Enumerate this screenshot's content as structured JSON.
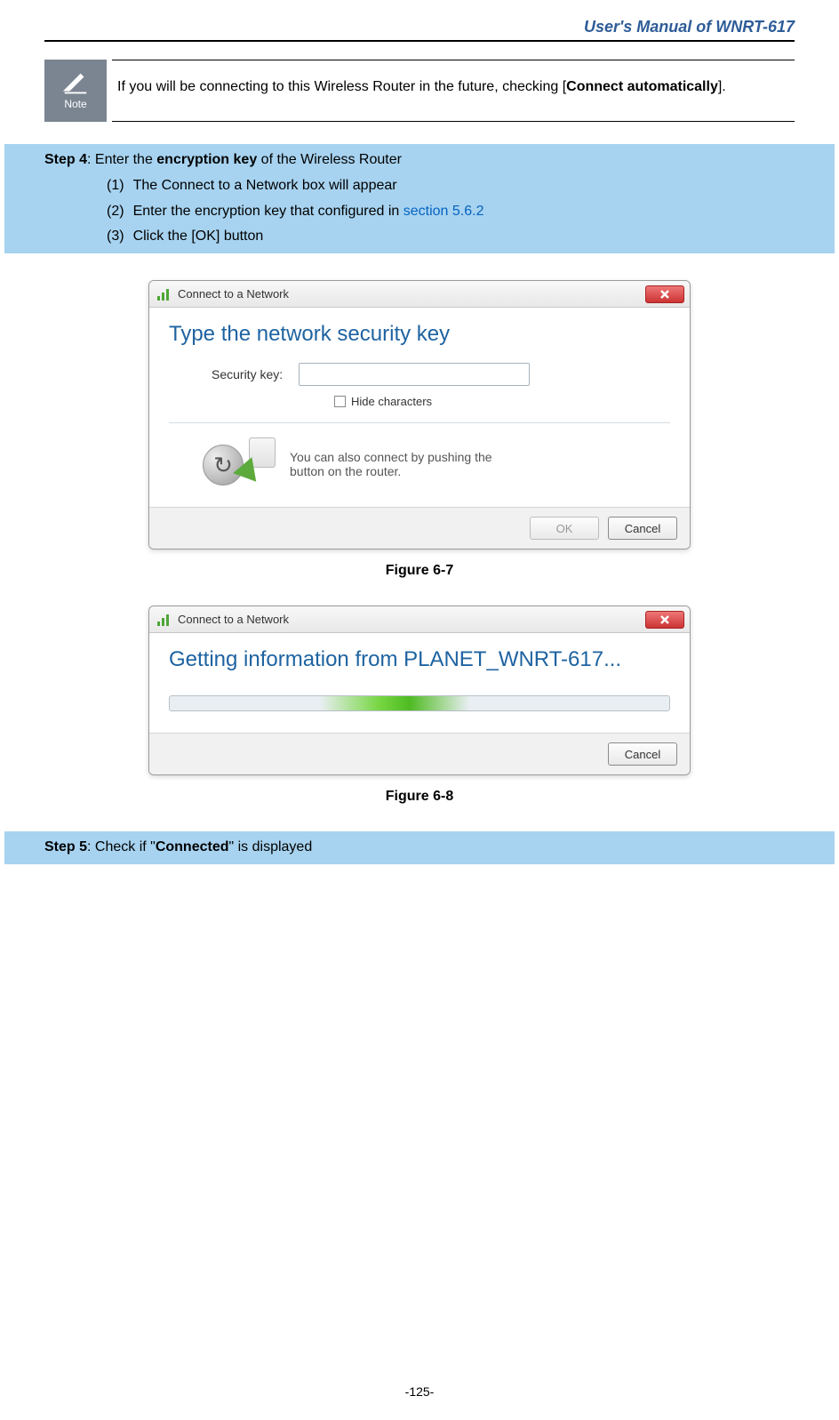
{
  "header": {
    "title": "User's Manual of WNRT-617"
  },
  "note": {
    "label": "Note",
    "text_before_bold": "If you will be connecting to this Wireless Router in the future, checking [",
    "bold": "Connect automatically",
    "text_after_bold": "]."
  },
  "step4": {
    "prefix": "Step 4",
    "text_before_bold": ": Enter the ",
    "bold": "encryption key",
    "text_after_bold": " of the Wireless Router",
    "items": [
      {
        "num": "(1)",
        "text": "The Connect to a Network box will appear"
      },
      {
        "num": "(2)",
        "text_before_link": "Enter the encryption key that configured in ",
        "link": "section 5.6.2"
      },
      {
        "num": "(3)",
        "text": "Click the [OK] button"
      }
    ]
  },
  "dialog1": {
    "title": "Connect to a Network",
    "heading": "Type the network security key",
    "security_label": "Security key:",
    "security_value": "",
    "hide_label": "Hide characters",
    "hint_line1": "You can also connect by pushing the",
    "hint_line2": "button on the router.",
    "ok": "OK",
    "cancel": "Cancel",
    "figure_label": "Figure 6-7"
  },
  "dialog2": {
    "title": "Connect to a Network",
    "heading": "Getting information from PLANET_WNRT-617...",
    "cancel": "Cancel",
    "figure_label": "Figure 6-8"
  },
  "step5": {
    "prefix": "Step 5",
    "text_before_bold": ": Check if \"",
    "bold": "Connected",
    "text_after_bold": "\" is displayed"
  },
  "page_number": "-125-"
}
